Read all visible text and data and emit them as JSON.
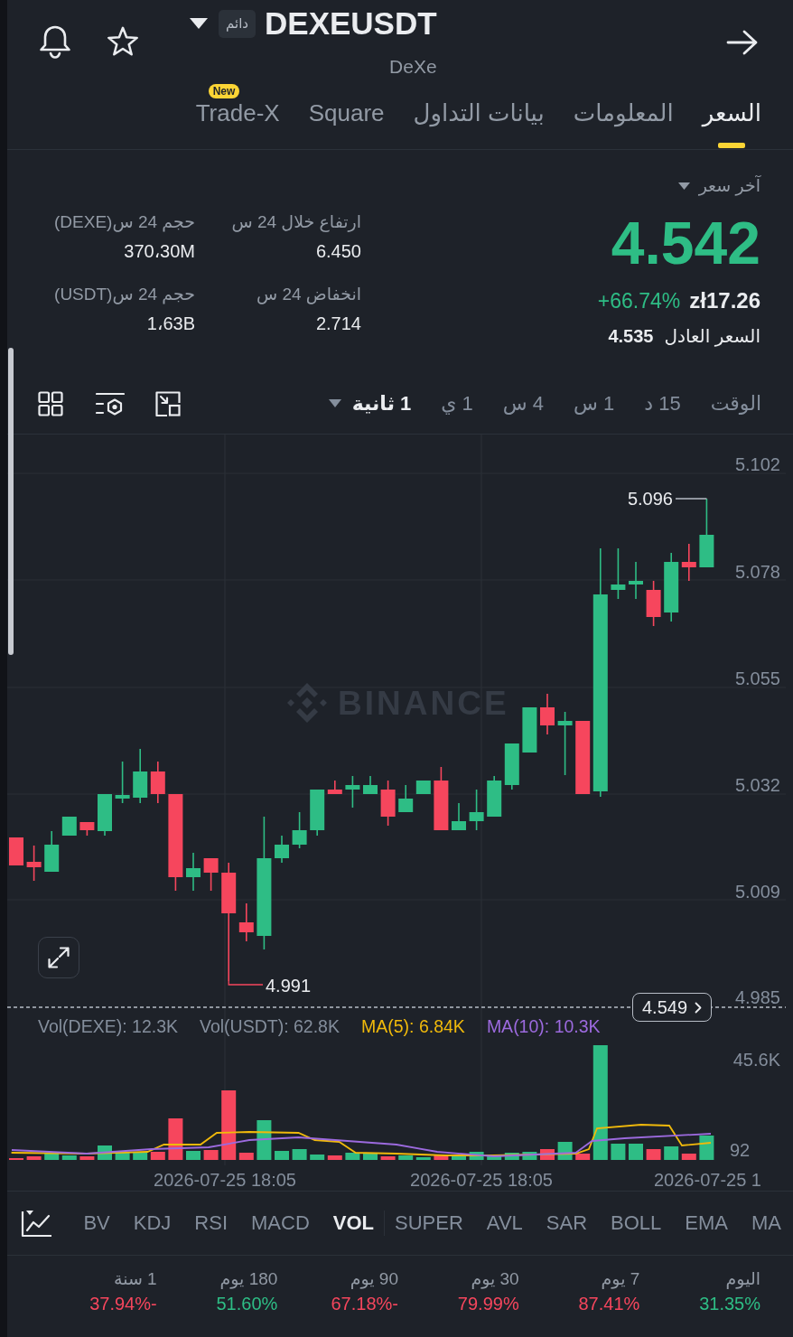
{
  "header": {
    "contract_badge": "دائم",
    "title": "DEXEUSDT",
    "subtitle": "DeXe"
  },
  "tabs": [
    {
      "label": "السعر",
      "selected": true
    },
    {
      "label": "المعلومات",
      "selected": false
    },
    {
      "label": "بيانات التداول",
      "selected": false
    },
    {
      "label": "Square",
      "selected": false
    },
    {
      "label": "Trade-X",
      "selected": false,
      "badge": "New"
    }
  ],
  "price_panel": {
    "label": "آخر سعر",
    "price": "4.542",
    "fiat": "zł17.26",
    "change": "+66.74%",
    "fair_price_label": "السعر العادل",
    "fair_price": "4.535"
  },
  "stats": [
    {
      "label": "ارتفاع خلال 24 س",
      "value": "6.450"
    },
    {
      "label": "حجم 24 س(DEXE)",
      "value": "370،30M"
    },
    {
      "label": "انخفاض 24 س",
      "value": "2.714"
    },
    {
      "label": "حجم 24 س(USDT)",
      "value": "1،63B"
    }
  ],
  "timeframes": [
    {
      "label": "الوقت",
      "selected": false,
      "kind": "tab"
    },
    {
      "label": "15 د",
      "selected": false,
      "kind": "tab"
    },
    {
      "label": "1 س",
      "selected": false,
      "kind": "tab"
    },
    {
      "label": "4 س",
      "selected": false,
      "kind": "tab"
    },
    {
      "label": "1 ي",
      "selected": false,
      "kind": "tab"
    },
    {
      "label": "1 ثانية",
      "selected": true,
      "kind": "dropdown"
    }
  ],
  "chart": {
    "watermark": "BINANCE",
    "price_axis": [
      "5.102",
      "5.078",
      "5.055",
      "5.032",
      "5.009",
      "4.985"
    ],
    "high_label": "5.096",
    "low_label": "4.991",
    "last_price": "4.549",
    "legend": [
      {
        "text": "MA(10): 10.3K",
        "color": "#9c6ade"
      },
      {
        "text": "MA(5): 6.84K",
        "color": "#f0b90b"
      },
      {
        "text": "Vol(USDT): 62.8K",
        "color": "#848e9c"
      },
      {
        "text": "Vol(DEXE): 12.3K",
        "color": "#848e9c"
      }
    ],
    "volume_axis": [
      "45.6K",
      "92"
    ],
    "time_axis": [
      "2026-07-25 1",
      "2026-07-25 18:05",
      "2026-07-25 18:05"
    ]
  },
  "indicators": {
    "main": [
      {
        "label": "MA",
        "selected": false
      },
      {
        "label": "EMA",
        "selected": false
      },
      {
        "label": "BOLL",
        "selected": false
      },
      {
        "label": "SAR",
        "selected": false
      },
      {
        "label": "AVL",
        "selected": false
      },
      {
        "label": "SUPER",
        "selected": false
      }
    ],
    "sub": [
      {
        "label": "VOL",
        "selected": true
      },
      {
        "label": "MACD",
        "selected": false
      },
      {
        "label": "RSI",
        "selected": false
      },
      {
        "label": "KDJ",
        "selected": false
      },
      {
        "label": "BV",
        "selected": false
      }
    ]
  },
  "performance": [
    {
      "period": "اليوم",
      "value": "31.35%",
      "color": "#2ebd85"
    },
    {
      "period": "7 يوم",
      "value": "87.41%",
      "color": "#f6465d"
    },
    {
      "period": "30 يوم",
      "value": "79.99%",
      "color": "#f6465d"
    },
    {
      "period": "90 يوم",
      "value": "67.18%-",
      "color": "#f6465d"
    },
    {
      "period": "180 يوم",
      "value": "51.60%",
      "color": "#2ebd85"
    },
    {
      "period": "1 سنة",
      "value": "37.94%-",
      "color": "#f6465d"
    }
  ]
}
